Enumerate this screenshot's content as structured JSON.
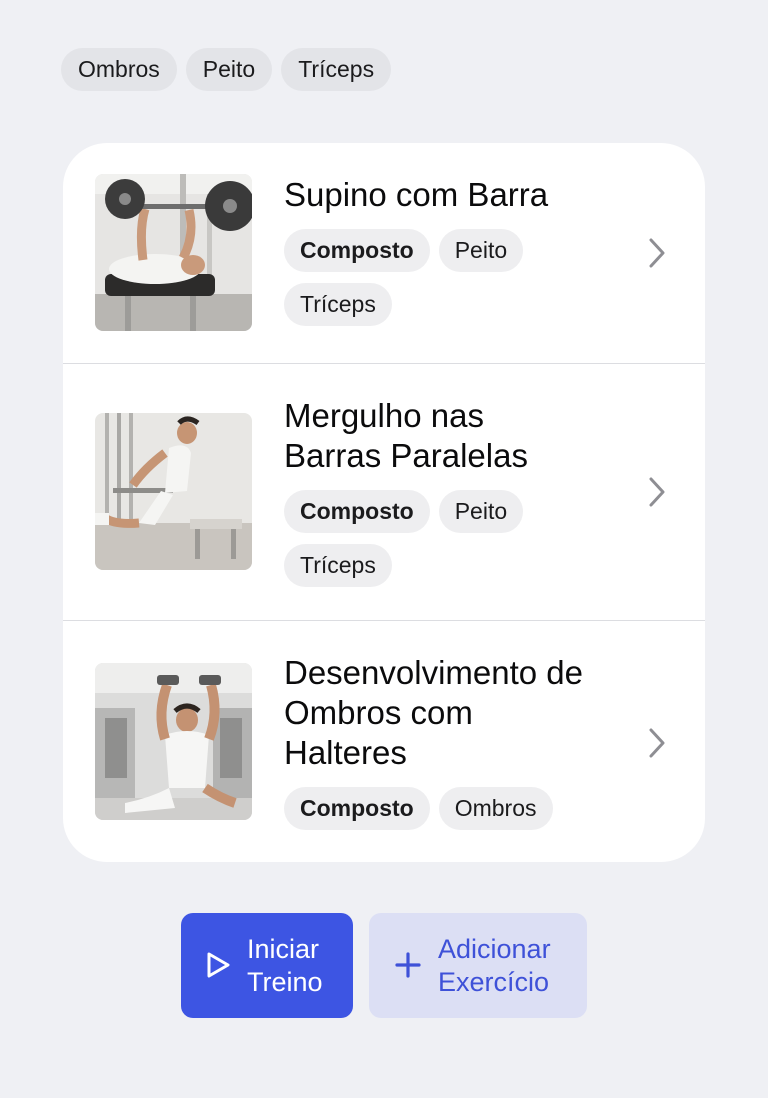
{
  "filters": [
    "Ombros",
    "Peito",
    "Tríceps"
  ],
  "exercises": [
    {
      "title": "Supino com Barra",
      "image": "bench-press-photo",
      "tags": [
        "Composto",
        "Peito",
        "Tríceps"
      ]
    },
    {
      "title": "Mergulho nas Barras Paralelas",
      "image": "parallel-bar-dips-photo",
      "tags": [
        "Composto",
        "Peito",
        "Tríceps"
      ]
    },
    {
      "title": "Desenvolvimento de Ombros com Halteres",
      "image": "dumbbell-shoulder-press-photo",
      "tags": [
        "Composto",
        "Ombros"
      ]
    }
  ],
  "actions": {
    "start": {
      "line1": "Iniciar",
      "line2": "Treino",
      "icon": "play-icon"
    },
    "add": {
      "line1": "Adicionar",
      "line2": "Exercício",
      "icon": "plus-icon"
    }
  },
  "icons": {
    "row_chevron": "chevron-right-icon"
  },
  "colors": {
    "background": "#eff0f4",
    "primary": "#3d55e3",
    "secondary_bg": "#dcdff4",
    "secondary_text": "#3e51d8",
    "chip_bg": "#e3e4e8"
  }
}
